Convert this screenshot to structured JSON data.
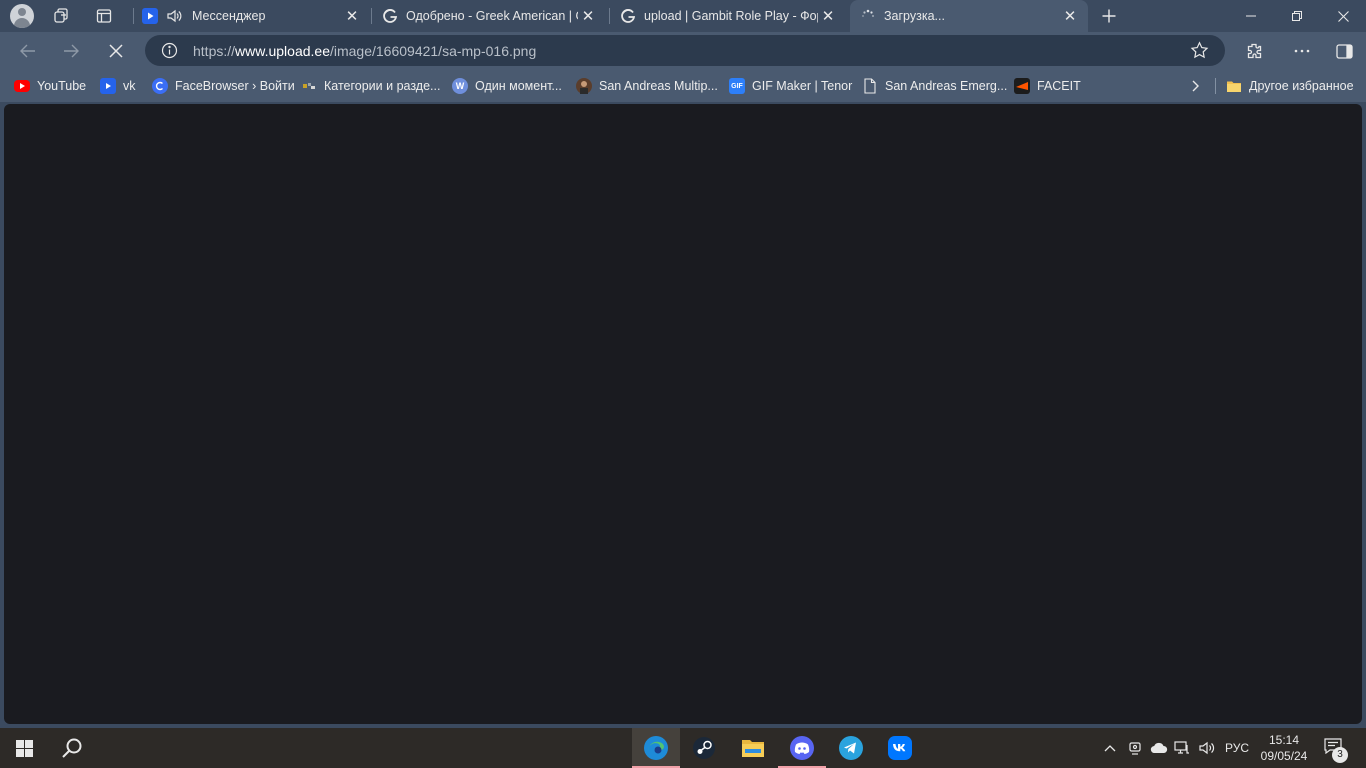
{
  "tabs": [
    {
      "title": "Мессенджер",
      "favicon": "messenger-video-icon",
      "audio": true,
      "active": false
    },
    {
      "title": "Одобрено - Greek American | Gambit",
      "favicon": "gambit-icon",
      "audio": false,
      "active": false
    },
    {
      "title": "upload | Gambit Role Play - Форум",
      "favicon": "gambit-icon",
      "audio": false,
      "active": false
    },
    {
      "title": "Загрузка...",
      "favicon": "loading-spinner-icon",
      "audio": false,
      "active": true
    }
  ],
  "address": {
    "scheme": "https://",
    "host": "www.upload.ee",
    "path": "/image/16609421/sa-mp-016.png"
  },
  "bookmarks": [
    {
      "label": "YouTube",
      "icon": "youtube-icon",
      "color": "#ff0000"
    },
    {
      "label": "vk",
      "icon": "video-icon",
      "color": "#2563eb"
    },
    {
      "label": "FaceBrowser › Войти",
      "icon": "facebrowser-icon",
      "color": "#3b6ef5"
    },
    {
      "label": "Категории и разде...",
      "icon": "category-icon",
      "color": "#c9a227"
    },
    {
      "label": "Один момент...",
      "icon": "w-icon",
      "color": "#6f8fdc"
    },
    {
      "label": "San Andreas Multip...",
      "icon": "samp-avatar-icon",
      "color": "#5a3d2b"
    },
    {
      "label": "GIF Maker | Tenor",
      "icon": "gif-icon",
      "color": "#2d7ff9"
    },
    {
      "label": "San Andreas Emerg...",
      "icon": "page-icon",
      "color": "#ffffff"
    },
    {
      "label": "FACEIT",
      "icon": "faceit-icon",
      "color": "#ff5500"
    }
  ],
  "bookmarks_other": {
    "label": "Другое избранное",
    "icon": "folder-icon"
  },
  "colors": {
    "titlebar": "#3b4a5f",
    "toolbar": "#4a5a70",
    "content_bg": "#1a1b20",
    "taskbar": "#2d2a27"
  },
  "taskbar": {
    "apps": [
      "edge-icon",
      "steam-icon",
      "file-explorer-icon",
      "discord-icon",
      "telegram-icon",
      "vk-icon"
    ],
    "language": "РУС",
    "time": "15:14",
    "date": "09/05/24",
    "notifications": "3"
  }
}
